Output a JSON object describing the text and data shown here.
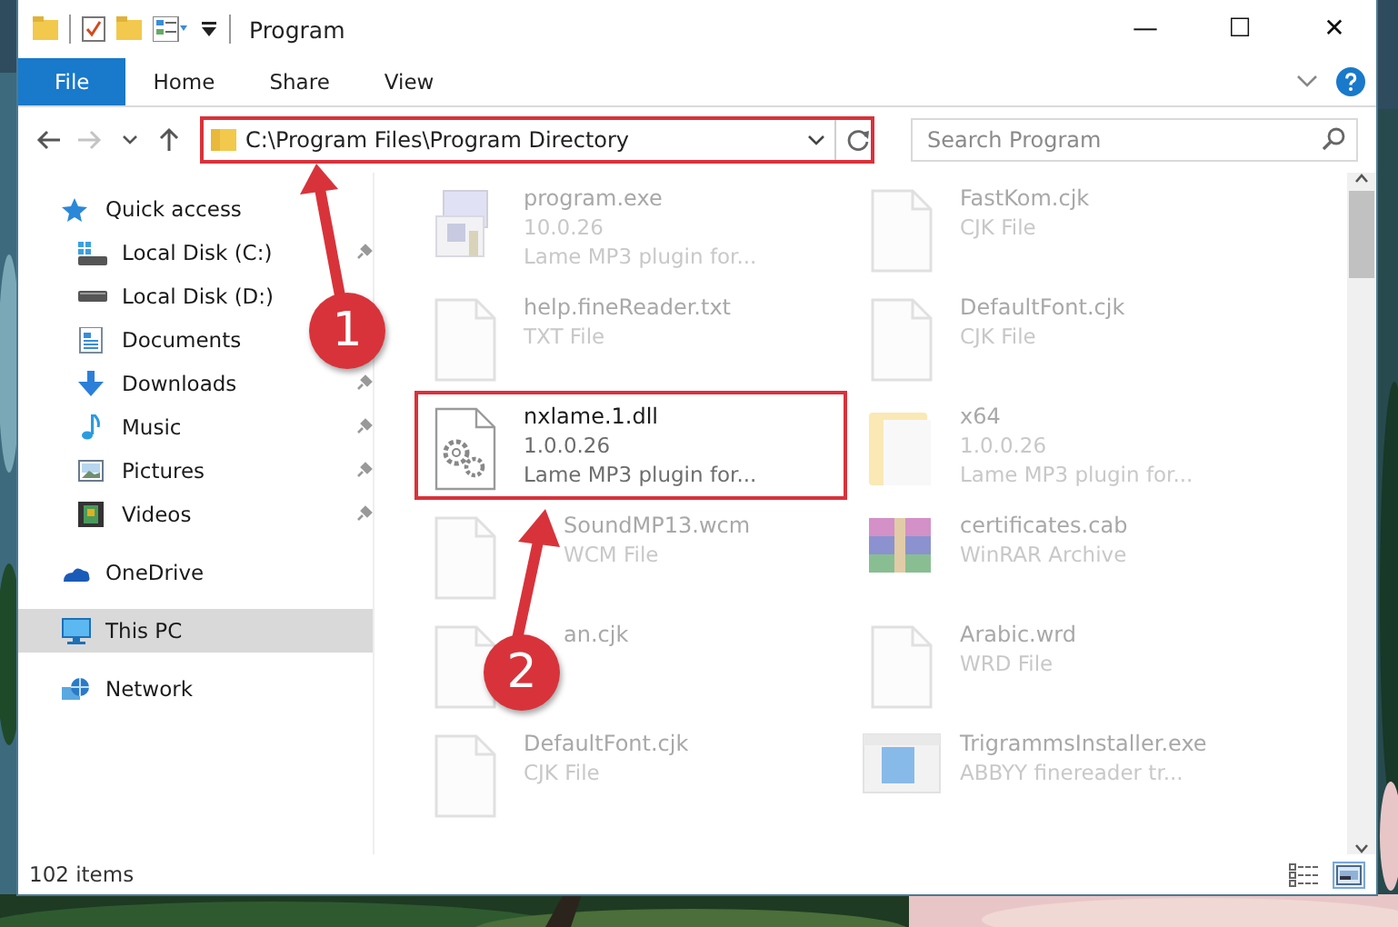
{
  "window": {
    "title": "Program",
    "minimize": "—",
    "maximize": "☐",
    "close": "✕"
  },
  "ribbon": {
    "tabs": [
      {
        "label": "File",
        "selected": true
      },
      {
        "label": "Home",
        "selected": false
      },
      {
        "label": "Share",
        "selected": false
      },
      {
        "label": "View",
        "selected": false
      }
    ]
  },
  "address_bar": {
    "path": "C:\\Program Files\\Program Directory",
    "highlighted": true,
    "forward_disabled": true
  },
  "search": {
    "placeholder": "Search Program"
  },
  "navigation": {
    "items": [
      {
        "label": "Quick access",
        "kind": "star",
        "selected": false,
        "children": [
          {
            "label": "Local Disk (C:)",
            "kind": "drive-windows",
            "pinned": true,
            "selected": false
          },
          {
            "label": "Local Disk (D:)",
            "kind": "drive",
            "pinned": false,
            "selected": false
          },
          {
            "label": "Documents",
            "kind": "documents",
            "pinned": false,
            "selected": false
          },
          {
            "label": "Downloads",
            "kind": "downloads",
            "pinned": true,
            "selected": false
          },
          {
            "label": "Music",
            "kind": "music",
            "pinned": true,
            "selected": false
          },
          {
            "label": "Pictures",
            "kind": "pictures",
            "pinned": true,
            "selected": false
          },
          {
            "label": "Videos",
            "kind": "videos",
            "pinned": true,
            "selected": false
          }
        ]
      },
      {
        "label": "OneDrive",
        "kind": "cloud",
        "selected": false
      },
      {
        "label": "This PC",
        "kind": "computer",
        "selected": true
      },
      {
        "label": "Network",
        "kind": "network",
        "selected": false
      }
    ]
  },
  "files": {
    "items": [
      {
        "name": "program.exe",
        "details": [
          "10.0.26",
          "Lame MP3 plugin for..."
        ],
        "kind": "program",
        "dimmed": true,
        "highlighted": false,
        "covered": false
      },
      {
        "name": "FastKom.cjk",
        "details": [
          "CJK File"
        ],
        "kind": "document",
        "dimmed": true,
        "highlighted": false,
        "covered": false
      },
      {
        "name": "help.fineReader.txt",
        "details": [
          "TXT File"
        ],
        "kind": "document",
        "dimmed": true,
        "highlighted": false,
        "covered": false
      },
      {
        "name": "DefaultFont.cjk",
        "details": [
          "CJK File"
        ],
        "kind": "document",
        "dimmed": true,
        "highlighted": false,
        "covered": false
      },
      {
        "name": "nxlame.1.dll",
        "details": [
          "1.0.0.26",
          "Lame MP3 plugin for..."
        ],
        "kind": "settings",
        "dimmed": false,
        "highlighted": true,
        "covered": false
      },
      {
        "name": "x64",
        "details": [
          "1.0.0.26",
          "Lame MP3 plugin for..."
        ],
        "kind": "folder",
        "dimmed": true,
        "highlighted": false,
        "covered": false
      },
      {
        "name": "SoundMP13.wcm",
        "details": [
          "WCM File"
        ],
        "kind": "document",
        "dimmed": true,
        "highlighted": false,
        "covered": true
      },
      {
        "name": "certificates.cab",
        "details": [
          "WinRAR Archive"
        ],
        "kind": "archive",
        "dimmed": true,
        "highlighted": false,
        "covered": false
      },
      {
        "name": "an.cjk",
        "kind": "document",
        "dimmed": true,
        "highlighted": false,
        "covered": true
      },
      {
        "name": "Arabic.wrd",
        "details": [
          "WRD File"
        ],
        "kind": "document",
        "dimmed": true,
        "highlighted": false,
        "covered": false
      },
      {
        "name": "DefaultFont.cjk",
        "details": [
          "CJK File"
        ],
        "kind": "document",
        "dimmed": true,
        "highlighted": false,
        "covered": false
      },
      {
        "name": "TrigrammsInstaller.exe",
        "details": [
          "ABBYY finereader tr..."
        ],
        "kind": "installer",
        "dimmed": true,
        "highlighted": false,
        "covered": false
      }
    ]
  },
  "status_bar": {
    "count": "102 items",
    "views": [
      {
        "kind": "details",
        "selected": false
      },
      {
        "kind": "large-icons",
        "selected": true
      }
    ]
  },
  "annotations": [
    {
      "number": "1"
    },
    {
      "number": "2"
    }
  ]
}
